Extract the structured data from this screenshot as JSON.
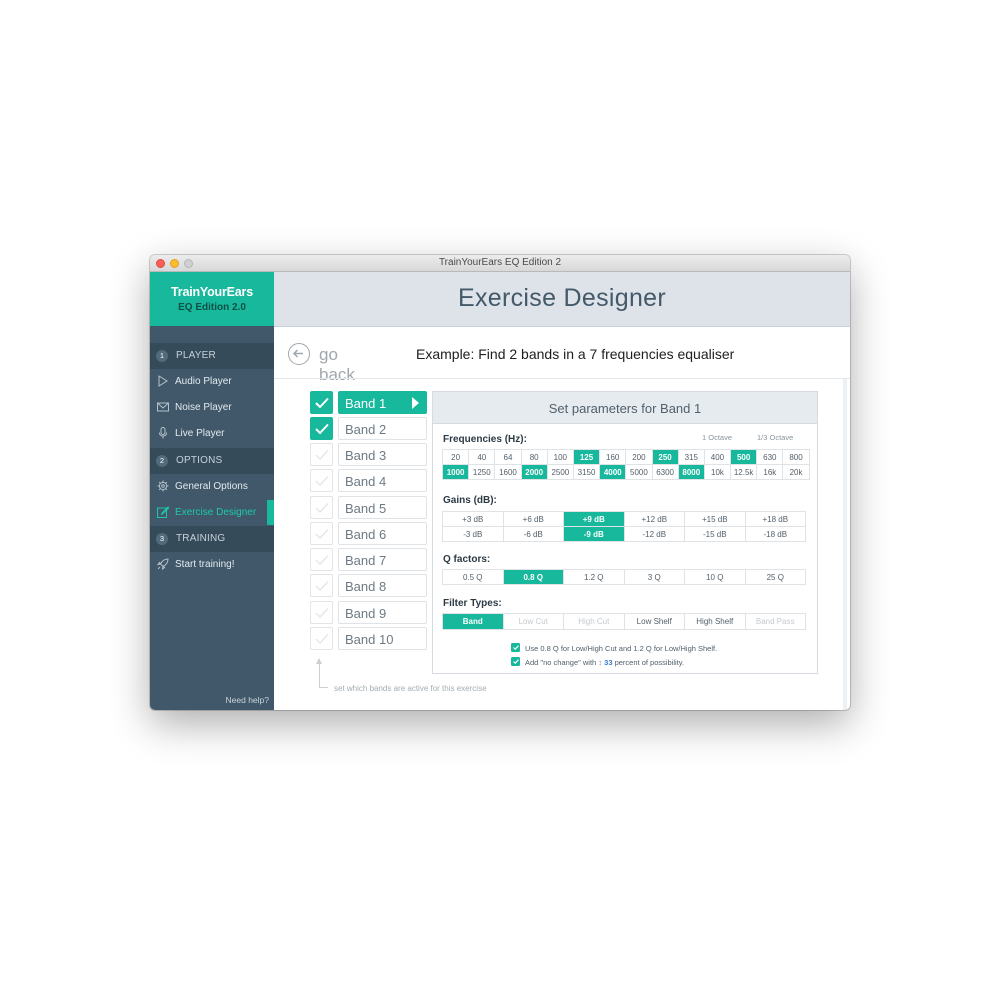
{
  "window": {
    "title": "TrainYourEars EQ Edition 2"
  },
  "sidebar": {
    "brand": {
      "name": "TrainYourEars",
      "edition": "EQ Edition 2.0"
    },
    "sections": [
      {
        "num": "1",
        "label": "PLAYER"
      },
      {
        "num": "2",
        "label": "OPTIONS"
      },
      {
        "num": "3",
        "label": "TRAINING"
      }
    ],
    "items": [
      {
        "label": "Audio Player",
        "icon": "play-icon"
      },
      {
        "label": "Noise Player",
        "icon": "envelope-icon"
      },
      {
        "label": "Live Player",
        "icon": "microphone-icon"
      },
      {
        "label": "General Options",
        "icon": "gear-icon"
      },
      {
        "label": "Exercise Designer",
        "icon": "edit-icon",
        "active": true
      },
      {
        "label": "Start training!",
        "icon": "rocket-icon"
      }
    ],
    "help": "Need help?"
  },
  "header": {
    "title": "Exercise Designer"
  },
  "goback": {
    "label": "go back"
  },
  "example": {
    "title": "Example: Find 2 bands in a 7 frequencies equaliser"
  },
  "bands": [
    {
      "label": "Band 1",
      "active": true,
      "selected": true
    },
    {
      "label": "Band 2",
      "active": true
    },
    {
      "label": "Band 3",
      "active": false
    },
    {
      "label": "Band 4",
      "active": false
    },
    {
      "label": "Band 5",
      "active": false
    },
    {
      "label": "Band 6",
      "active": false
    },
    {
      "label": "Band 7",
      "active": false
    },
    {
      "label": "Band 8",
      "active": false
    },
    {
      "label": "Band 9",
      "active": false
    },
    {
      "label": "Band 10",
      "active": false
    }
  ],
  "panel": {
    "title": "Set parameters for Band 1",
    "frequencies": {
      "label": "Frequencies (Hz):",
      "octave_label": "1 Octave",
      "third_octave_label": "1/3 Octave",
      "values": [
        "20",
        "40",
        "64",
        "80",
        "100",
        "125",
        "160",
        "200",
        "250",
        "315",
        "400",
        "500",
        "630",
        "800",
        "1000",
        "1250",
        "1600",
        "2000",
        "2500",
        "3150",
        "4000",
        "5000",
        "6300",
        "8000",
        "10k",
        "12.5k",
        "16k",
        "20k"
      ],
      "selected": [
        "125",
        "250",
        "500",
        "1000",
        "2000",
        "4000",
        "8000"
      ]
    },
    "gains": {
      "label": "Gains (dB):",
      "values": [
        "+3 dB",
        "+6 dB",
        "+9 dB",
        "+12 dB",
        "+15 dB",
        "+18 dB",
        "-3 dB",
        "-6 dB",
        "-9 dB",
        "-12 dB",
        "-15 dB",
        "-18 dB"
      ],
      "selected": [
        "+9 dB",
        "-9 dB"
      ]
    },
    "q_factors": {
      "label": "Q factors:",
      "values": [
        "0.5 Q",
        "0.8 Q",
        "1.2 Q",
        "3 Q",
        "10 Q",
        "25 Q"
      ],
      "selected": [
        "0.8 Q"
      ]
    },
    "filter_types": {
      "label": "Filter Types:",
      "values": [
        "Band",
        "Low Cut",
        "High Cut",
        "Low Shelf",
        "High Shelf",
        "Band Pass"
      ],
      "selected": [
        "Band"
      ],
      "disabled": [
        "Low Cut",
        "High Cut",
        "Band Pass"
      ]
    },
    "options": {
      "q_option": "Use 0.8 Q for Low/High Cut and 1.2 Q for Low/High Shelf.",
      "no_change_prefix": "Add \"no change\" with",
      "no_change_value": "33",
      "no_change_suffix": "percent of possibility."
    }
  },
  "hint": "set which bands are active for this exercise",
  "colors": {
    "accent": "#17b89c",
    "sidebar": "#405869",
    "header": "#dde3e8"
  }
}
